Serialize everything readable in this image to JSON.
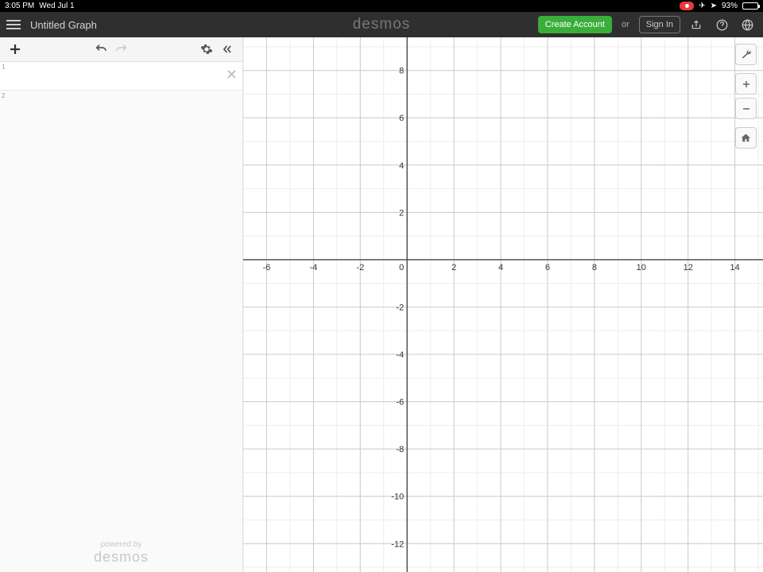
{
  "statusbar": {
    "time": "3:05 PM",
    "date": "Wed Jul 1",
    "battery_pct": "93%",
    "airplane_icon": "✈",
    "location_icon": "➤"
  },
  "appbar": {
    "title": "Untitled Graph",
    "brand": "desmos",
    "create_account": "Create Account",
    "or": "or",
    "sign_in": "Sign In"
  },
  "sidebar": {
    "rows": [
      {
        "num": "1"
      },
      {
        "num": "2"
      }
    ],
    "powered_by": "powered by",
    "powered_brand": "desmos"
  },
  "graph": {
    "x_ticks": [
      -6,
      -4,
      -2,
      0,
      2,
      4,
      6,
      8,
      10,
      12,
      14
    ],
    "y_ticks": [
      8,
      6,
      4,
      2,
      -2,
      -4,
      -6,
      -8,
      -10,
      -12
    ],
    "x_min": -7,
    "x_max": 15.2,
    "y_min": -13.2,
    "y_max": 9.4
  },
  "chart_data": {
    "type": "scatter",
    "series": [],
    "title": "",
    "xlabel": "",
    "ylabel": "",
    "x_range": [
      -7,
      15.2
    ],
    "y_range": [
      -13.2,
      9.4
    ],
    "grid": true,
    "origin": [
      0,
      0
    ]
  }
}
